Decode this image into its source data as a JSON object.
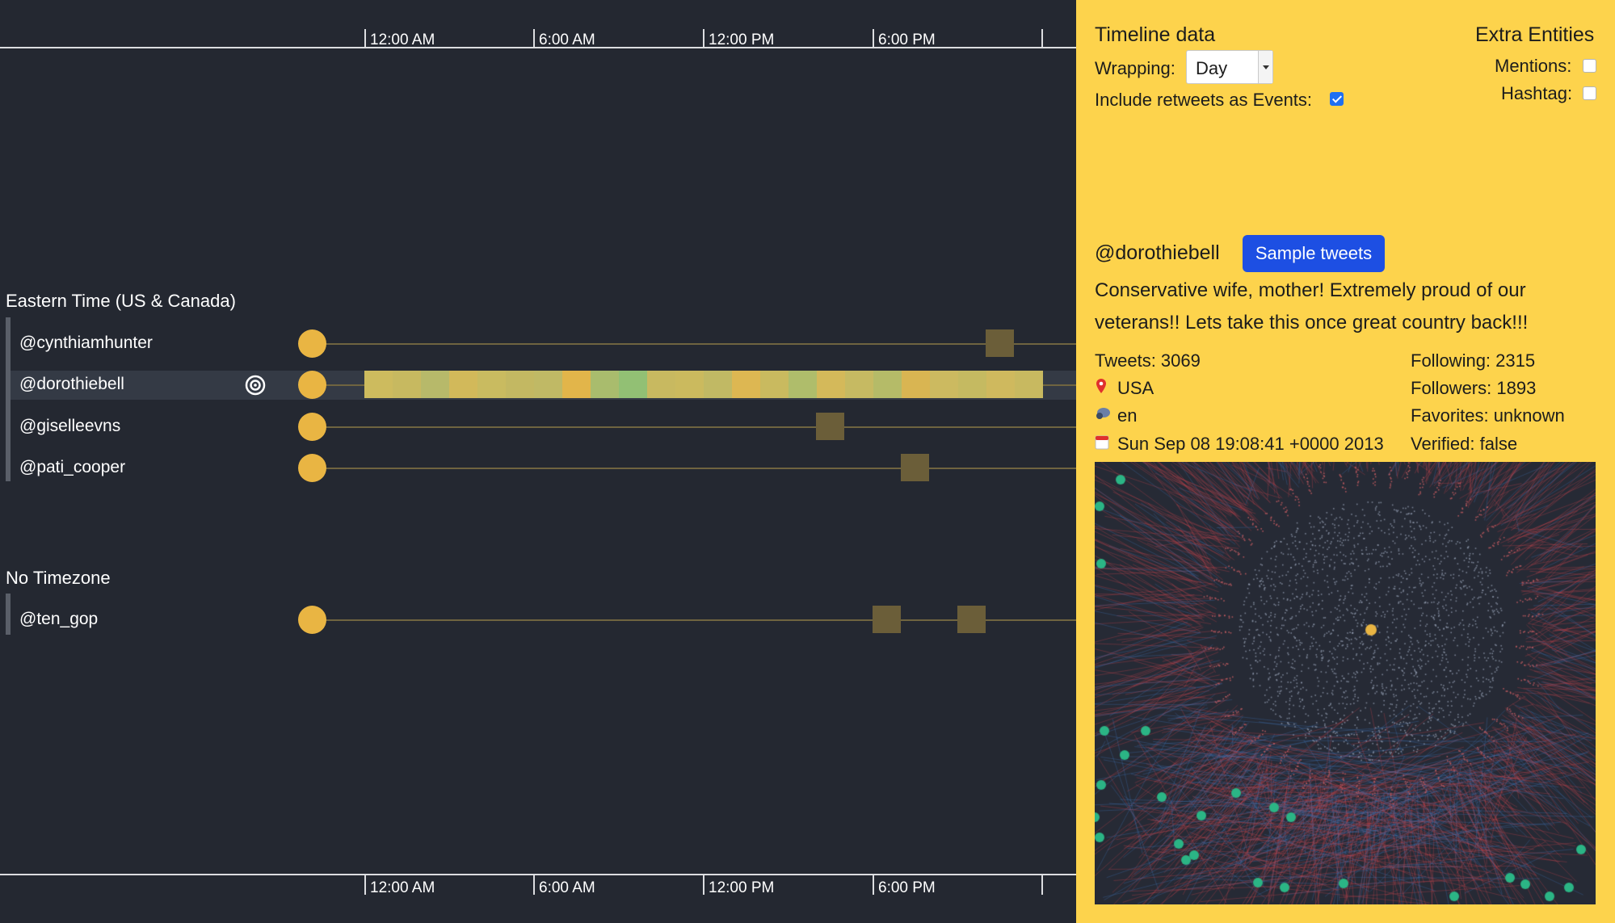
{
  "timeline": {
    "ticks": [
      "12:00 AM",
      "6:00 AM",
      "12:00 PM",
      "6:00 PM",
      ""
    ],
    "groups": [
      {
        "title": "Eastern Time (US & Canada)",
        "rows": [
          {
            "label": "@cynthiamhunter"
          },
          {
            "label": "@dorothiebell"
          },
          {
            "label": "@giselleevns"
          },
          {
            "label": "@pati_cooper"
          }
        ]
      },
      {
        "title": "No Timezone",
        "rows": [
          {
            "label": "@ten_gop"
          }
        ]
      }
    ]
  },
  "panel": {
    "title": "Timeline data",
    "wrapping_label": "Wrapping:",
    "wrapping_value": "Day",
    "retweets_label": "Include retweets as Events:",
    "retweets_checked": true,
    "extra_title": "Extra Entities",
    "mentions_label": "Mentions:",
    "hashtag_label": "Hashtag:",
    "user": {
      "handle": "@dorothiebell",
      "sample_button": "Sample tweets",
      "bio": "Conservative wife, mother! Extremely proud of our veterans!! Lets take this once great country back!!!",
      "tweets": "Tweets: 3069",
      "following": "Following: 2315",
      "location": "USA",
      "followers": "Followers: 1893",
      "language": "en",
      "favorites": "Favorites: unknown",
      "created": "Sun Sep 08 19:08:41 +0000 2013",
      "verified": "Verified: false"
    },
    "icons": [
      "map-pin-icon",
      "speech-bubble-icon",
      "calendar-icon"
    ]
  },
  "colors": {
    "background": "#242831",
    "panel": "#fdd34c",
    "accent_dot": "#e9b543",
    "event": "#6b5e39",
    "button": "#1d4fe3",
    "graph_bg": "#262a35",
    "node_green": "#2bb585",
    "edge_red": "#c8464c",
    "edge_blue": "#3e72b5"
  }
}
